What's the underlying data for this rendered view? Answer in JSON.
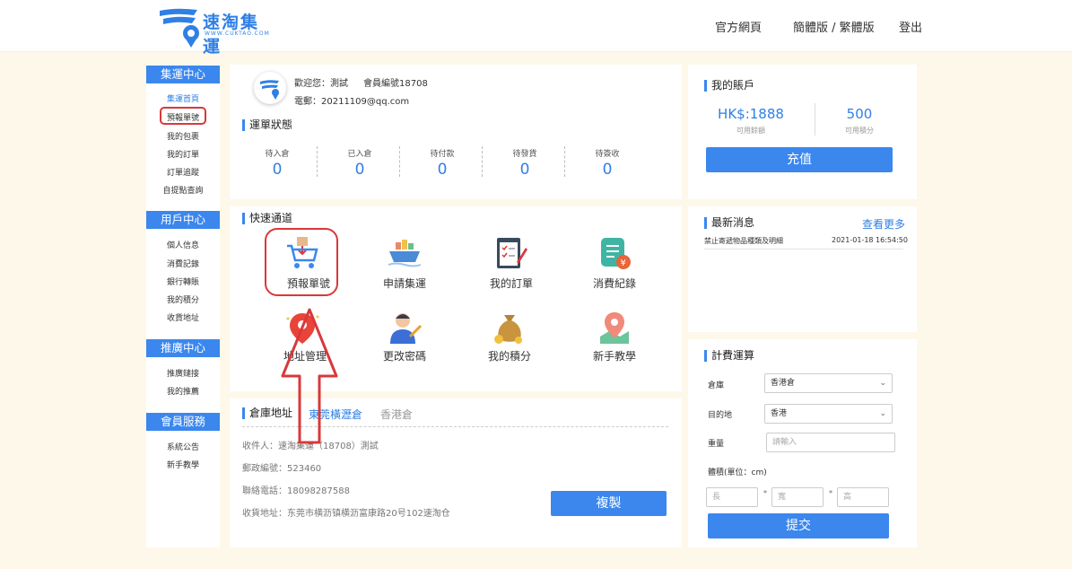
{
  "header": {
    "logo_text": "速淘集運",
    "logo_sub": "WWW.CUKTAO.COM",
    "nav_official": "官方網頁",
    "nav_lang": "簡體版 / 繁體版",
    "nav_logout": "登出"
  },
  "sidebar": {
    "sections": [
      {
        "title": "集運中心",
        "items": [
          "集運首頁",
          "預報單號",
          "我的包裹",
          "我的訂單",
          "訂單追蹤",
          "自提點查詢"
        ]
      },
      {
        "title": "用戶中心",
        "items": [
          "個人信息",
          "消費記錄",
          "銀行轉賬",
          "我的積分",
          "收貨地址"
        ]
      },
      {
        "title": "推廣中心",
        "items": [
          "推廣鏈接",
          "我的推薦"
        ]
      },
      {
        "title": "會員服務",
        "items": [
          "系統公告",
          "新手教學"
        ]
      }
    ]
  },
  "profile": {
    "welcome": "歡迎您：測試",
    "member_no": "會員編號18708",
    "email": "電郵：20211109@qq.com"
  },
  "status": {
    "title": "運單狀態",
    "items": [
      {
        "label": "待入倉",
        "value": "0"
      },
      {
        "label": "已入倉",
        "value": "0"
      },
      {
        "label": "待付款",
        "value": "0"
      },
      {
        "label": "待發貨",
        "value": "0"
      },
      {
        "label": "待簽收",
        "value": "0"
      }
    ]
  },
  "quick": {
    "title": "快速通道",
    "items": [
      "預報單號",
      "申請集運",
      "我的訂單",
      "消費紀錄",
      "地址管理",
      "更改密碼",
      "我的積分",
      "新手教學"
    ]
  },
  "warehouse": {
    "title": "倉庫地址",
    "tabs": [
      "東莞橫瀝倉",
      "香港倉"
    ],
    "recipient": "收件人：速淘集運（18708）測試",
    "postcode": "郵政編號：523460",
    "phone": "聯絡電話：18098287588",
    "address": "收貨地址：东莞市横沥镇横沥富康路20号102速淘仓",
    "copy_label": "複製"
  },
  "account": {
    "title": "我的賬戶",
    "balance": "HK$:1888",
    "balance_label": "可用餘額",
    "points": "500",
    "points_label": "可用積分",
    "recharge_label": "充值"
  },
  "news": {
    "title": "最新消息",
    "more": "查看更多",
    "items": [
      {
        "text": "禁止寄遞物品種類及明細",
        "date": "2021-01-18 16:54:50"
      }
    ]
  },
  "calc": {
    "title": "計費運算",
    "warehouse_label": "倉庫",
    "warehouse_value": "香港倉",
    "dest_label": "目的地",
    "dest_value": "香港",
    "weight_label": "重量",
    "weight_placeholder": "請輸入",
    "volume_label": "體積(單位：cm)",
    "length_ph": "長",
    "width_ph": "寬",
    "height_ph": "高",
    "submit_label": "提交"
  },
  "colors": {
    "accent": "#3b87ee",
    "highlight": "#d9383a",
    "background": "#fdf8e9"
  }
}
